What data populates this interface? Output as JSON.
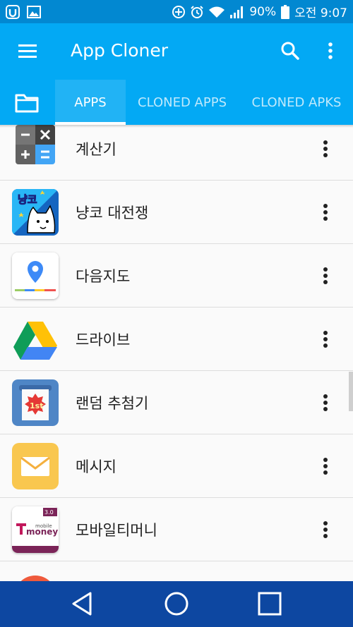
{
  "status_bar": {
    "battery": "90%",
    "time": "오전 9:07"
  },
  "app_bar": {
    "title": "App Cloner"
  },
  "tabs": [
    {
      "label": "APPS"
    },
    {
      "label": "CLONED APPS"
    },
    {
      "label": "CLONED APKS"
    }
  ],
  "apps": [
    {
      "name": "계산기",
      "icon": "calculator-icon"
    },
    {
      "name": "냥코 대전쟁",
      "icon": "battle-cats-icon"
    },
    {
      "name": "다음지도",
      "icon": "daum-map-icon"
    },
    {
      "name": "드라이브",
      "icon": "google-drive-icon"
    },
    {
      "name": "랜덤 추첨기",
      "icon": "random-draw-icon"
    },
    {
      "name": "메시지",
      "icon": "message-icon"
    },
    {
      "name": "모바일티머니",
      "icon": "mobile-tmoney-icon"
    }
  ],
  "icon_text": {
    "cats_logo": "냥코",
    "draw_badge": "1st",
    "tmoney_version": "3.0",
    "tmoney_mobile": "mobile",
    "tmoney_money": "money"
  },
  "colors": {
    "status_bar": "#0288d1",
    "app_bar": "#03a9f4",
    "nav_bar": "#0d47a1"
  }
}
